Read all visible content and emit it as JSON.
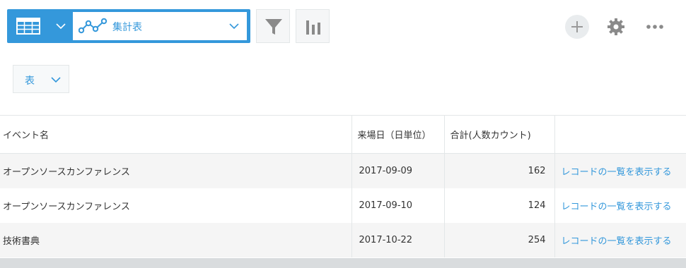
{
  "toolbar": {
    "view_icon": "table-icon",
    "graph_icon": "line-graph-icon",
    "graph_label": "集計表",
    "filter_icon": "filter-icon",
    "chart_icon": "bar-chart-icon",
    "add_icon": "plus-icon",
    "settings_icon": "gear-icon",
    "more_icon": "more-icon"
  },
  "display_type": {
    "label": "表"
  },
  "table": {
    "headers": {
      "event_name": "イベント名",
      "date": "来場日（日単位）",
      "count": "合計(人数カウント)",
      "link": ""
    },
    "rows": [
      {
        "event_name": "オープンソースカンファレンス",
        "date": "2017-09-09",
        "count": "162",
        "link": "レコードの一覧を表示する"
      },
      {
        "event_name": "オープンソースカンファレンス",
        "date": "2017-09-10",
        "count": "124",
        "link": "レコードの一覧を表示する"
      },
      {
        "event_name": "技術書典",
        "date": "2017-10-22",
        "count": "254",
        "link": "レコードの一覧を表示する"
      }
    ]
  },
  "colors": {
    "accent": "#3498db",
    "row_alt": "#f5f5f5",
    "icon_gray": "#888888"
  }
}
